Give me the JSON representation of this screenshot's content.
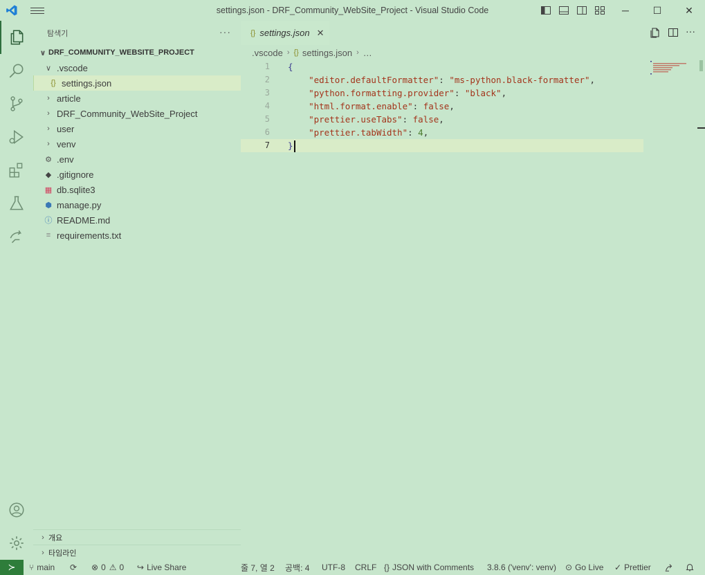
{
  "window": {
    "title": "settings.json - DRF_Community_WebSite_Project - Visual Studio Code",
    "controls": {
      "minimize": "─",
      "maximize": "☐",
      "close": "✕"
    }
  },
  "activity_bar": {
    "items": [
      {
        "name": "explorer-icon"
      },
      {
        "name": "search-icon"
      },
      {
        "name": "source-control-icon"
      },
      {
        "name": "run-debug-icon"
      },
      {
        "name": "extensions-icon"
      },
      {
        "name": "testing-icon"
      },
      {
        "name": "live-share-icon"
      }
    ],
    "bottom": [
      {
        "name": "account-icon"
      },
      {
        "name": "manage-gear-icon"
      }
    ]
  },
  "sidebar": {
    "title": "탐색기",
    "more": "···",
    "project": "DRF_COMMUNITY_WEBSITE_PROJECT",
    "tree": [
      {
        "label": ".vscode",
        "type": "folder-open",
        "depth": 1
      },
      {
        "label": "settings.json",
        "type": "json",
        "depth": 2,
        "selected": true
      },
      {
        "label": "article",
        "type": "folder",
        "depth": 1
      },
      {
        "label": "DRF_Community_WebSite_Project",
        "type": "folder",
        "depth": 1
      },
      {
        "label": "user",
        "type": "folder",
        "depth": 1
      },
      {
        "label": "venv",
        "type": "folder",
        "depth": 1
      },
      {
        "label": ".env",
        "type": "gear",
        "depth": 1
      },
      {
        "label": ".gitignore",
        "type": "git",
        "depth": 1
      },
      {
        "label": "db.sqlite3",
        "type": "db",
        "depth": 1
      },
      {
        "label": "manage.py",
        "type": "python",
        "depth": 1
      },
      {
        "label": "README.md",
        "type": "info",
        "depth": 1
      },
      {
        "label": "requirements.txt",
        "type": "text",
        "depth": 1
      }
    ],
    "bottom_sections": [
      "개요",
      "타임라인"
    ]
  },
  "editor": {
    "tab": {
      "icon": "{}",
      "label": "settings.json",
      "close": "✕"
    },
    "breadcrumb": {
      "folder": ".vscode",
      "file_icon": "{}",
      "file": "settings.json",
      "trail": "…"
    },
    "lines": [
      {
        "num": "1",
        "text": "{"
      },
      {
        "num": "2",
        "key": "\"editor.defaultFormatter\"",
        "value": "\"ms-python.black-formatter\"",
        "vtype": "s"
      },
      {
        "num": "3",
        "key": "\"python.formatting.provider\"",
        "value": "\"black\"",
        "vtype": "s"
      },
      {
        "num": "4",
        "key": "\"html.format.enable\"",
        "value": "false",
        "vtype": "b"
      },
      {
        "num": "5",
        "key": "\"prettier.useTabs\"",
        "value": "false",
        "vtype": "b"
      },
      {
        "num": "6",
        "key": "\"prettier.tabWidth\"",
        "value": "4",
        "vtype": "n"
      },
      {
        "num": "7",
        "text": "}",
        "current": true
      }
    ]
  },
  "status_bar": {
    "remote": "≻",
    "branch": "main",
    "sync": "⟳",
    "errors": "0",
    "warnings": "0",
    "live_share": "Live Share",
    "position": "줄 7, 열 2",
    "spaces": "공백: 4",
    "encoding": "UTF-8",
    "eol": "CRLF",
    "language": "JSON with Comments",
    "interpreter": "3.8.6 ('venv': venv)",
    "go_live": "Go Live",
    "prettier": "Prettier"
  },
  "colors": {
    "background": "#c7e6cc",
    "accent": "#2e7d3a",
    "string": "#a3341b"
  }
}
